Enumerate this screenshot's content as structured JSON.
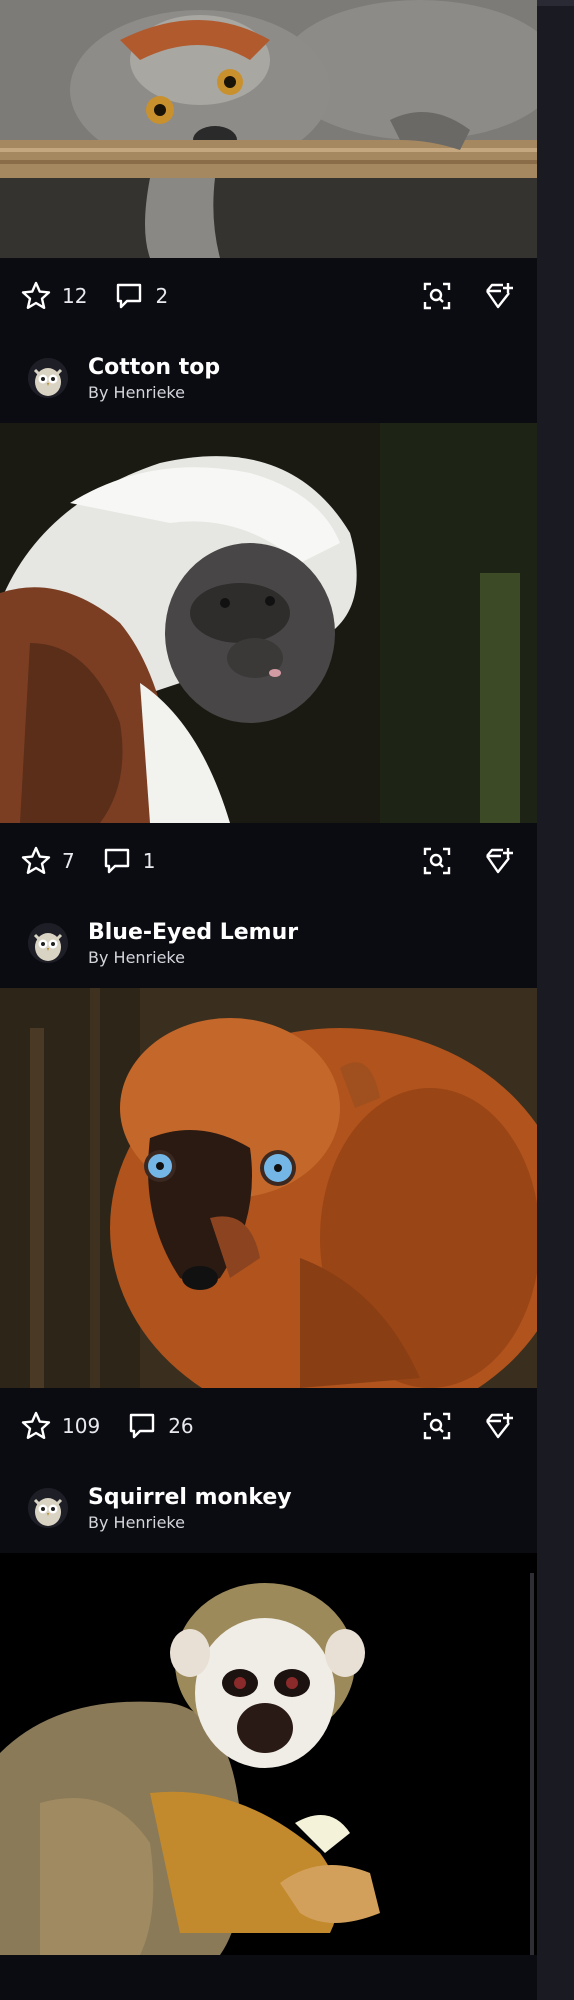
{
  "posts": [
    {
      "title": "",
      "author": "",
      "image_alt": "crowned lemur resting on a wooden rail",
      "stars": "12",
      "comments": "2"
    },
    {
      "title": "Cotton top",
      "author": "By Henrieke",
      "image_alt": "cotton-top tamarin with white crest",
      "stars": "7",
      "comments": "1"
    },
    {
      "title": "Blue-Eyed Lemur",
      "author": "By Henrieke",
      "image_alt": "blue-eyed black lemur with orange fur",
      "stars": "109",
      "comments": "26"
    },
    {
      "title": "Squirrel monkey",
      "author": "By Henrieke",
      "image_alt": "squirrel monkey holding food",
      "stars": "",
      "comments": ""
    }
  ],
  "icons": {
    "star": "star-icon",
    "comment": "comment-icon",
    "zoom": "zoom-icon",
    "add_to_collection": "gem-plus-icon",
    "avatar": "owl-avatar"
  },
  "colors": {
    "background": "#0b0b12",
    "text": "#ffffff",
    "muted": "#d4d4dc"
  }
}
